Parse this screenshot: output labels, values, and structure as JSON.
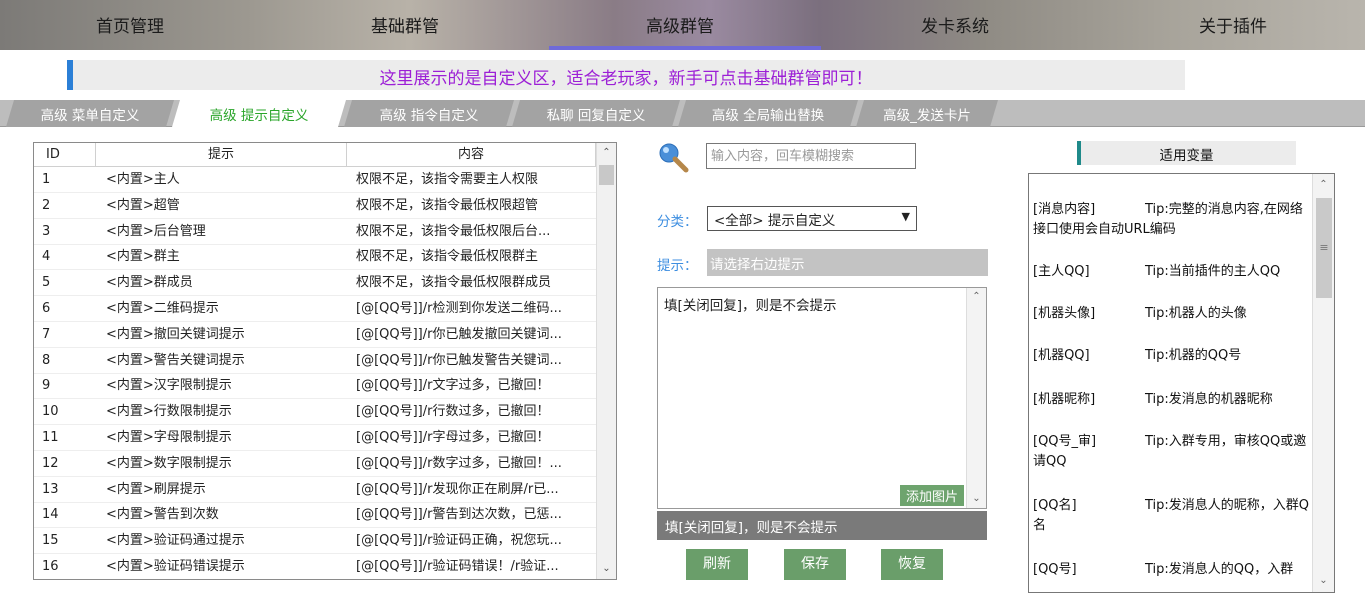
{
  "nav": {
    "items": [
      "首页管理",
      "基础群管",
      "高级群管",
      "发卡系统",
      "关于插件"
    ],
    "active": "高级群管"
  },
  "notice": "这里展示的是自定义区，适合老玩家，新手可点击基础群管即可！",
  "tabs": [
    "高级 菜单自定义",
    "高级 提示自定义",
    "高级 指令自定义",
    "私聊 回复自定义",
    "高级 全局输出替换",
    "高级_发送卡片"
  ],
  "active_tab": "高级 提示自定义",
  "table": {
    "headers": [
      "ID",
      "提示",
      "内容"
    ],
    "rows": [
      [
        "1",
        "<内置>主人",
        "权限不足，该指令需要主人权限"
      ],
      [
        "2",
        "<内置>超管",
        "权限不足，该指令最低权限超管"
      ],
      [
        "3",
        "<内置>后台管理",
        "权限不足，该指令最低权限后台..."
      ],
      [
        "4",
        "<内置>群主",
        "权限不足，该指令最低权限群主"
      ],
      [
        "5",
        "<内置>群成员",
        "权限不足，该指令最低权限群成员"
      ],
      [
        "6",
        "<内置>二维码提示",
        "[@[QQ号]]/r检测到你发送二维码..."
      ],
      [
        "7",
        "<内置>撤回关键词提示",
        "[@[QQ号]]/r你已触发撤回关键词..."
      ],
      [
        "8",
        "<内置>警告关键词提示",
        "[@[QQ号]]/r你已触发警告关键词..."
      ],
      [
        "9",
        "<内置>汉字限制提示",
        "[@[QQ号]]/r文字过多，已撤回！"
      ],
      [
        "10",
        "<内置>行数限制提示",
        "[@[QQ号]]/r行数过多，已撤回！"
      ],
      [
        "11",
        "<内置>字母限制提示",
        "[@[QQ号]]/r字母过多，已撤回！"
      ],
      [
        "12",
        "<内置>数字限制提示",
        "[@[QQ号]]/r数字过多，已撤回！..."
      ],
      [
        "13",
        "<内置>刷屏提示",
        "[@[QQ号]]/r发现你正在刷屏/r已..."
      ],
      [
        "14",
        "<内置>警告到次数",
        "[@[QQ号]]/r警告到达次数，已惩..."
      ],
      [
        "15",
        "<内置>验证码通过提示",
        "[@[QQ号]]/r验证码正确，祝您玩..."
      ],
      [
        "16",
        "<内置>验证码错误提示",
        "[@[QQ号]]/r验证码错误！/r验证..."
      ]
    ]
  },
  "search": {
    "placeholder": "输入内容，回车模糊搜索"
  },
  "category": {
    "label": "分类：",
    "value": "<全部> 提示自定义"
  },
  "tip": {
    "label": "提示：",
    "placeholder": "请选择右边提示"
  },
  "editor": {
    "text": "填[关闭回复]，则是不会提示",
    "add_image": "添加图片"
  },
  "preview_text": "填[关闭回复]，则是不会提示",
  "buttons": {
    "refresh": "刷新",
    "save": "保存",
    "restore": "恢复"
  },
  "variables": {
    "title": "适用变量",
    "items": [
      {
        "key": "[消息内容]",
        "tip": "Tip:完整的消息内容,在网络接口使用会自动URL编码"
      },
      {
        "key": "[主人QQ]",
        "tip": "Tip:当前插件的主人QQ"
      },
      {
        "key": "[机器头像]",
        "tip": "Tip:机器人的头像"
      },
      {
        "key": "[机器QQ]",
        "tip": "Tip:机器的QQ号"
      },
      {
        "key": "[机器昵称]",
        "tip": "Tip:发消息的机器昵称"
      },
      {
        "key": "[QQ号_审]",
        "tip": "Tip:入群专用，审核QQ或邀请QQ"
      },
      {
        "key": "[QQ名]",
        "tip": "Tip:发消息人的昵称，入群Q名"
      },
      {
        "key": "[QQ号]",
        "tip": "Tip:发消息人的QQ，入群"
      }
    ]
  },
  "colors": {
    "accent_blue": "#2b7fd6",
    "notice_text": "#9c1fd6",
    "active_tab_text": "#2aa52a",
    "button_green": "#6a9e6a"
  }
}
